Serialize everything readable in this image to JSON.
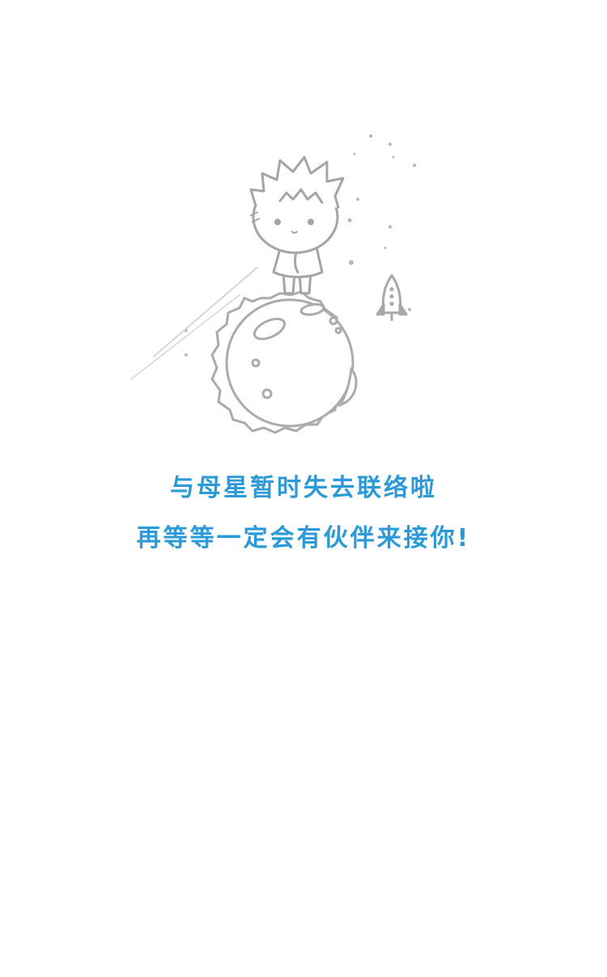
{
  "empty_state": {
    "illustration": "little-prince-on-planet-illustration",
    "line1": "与母星暂时失去联络啦",
    "line2": "再等等一定会有伙伴来接你!",
    "text_color": "#2b9ad6",
    "illustration_color": "#a9a9a9"
  }
}
